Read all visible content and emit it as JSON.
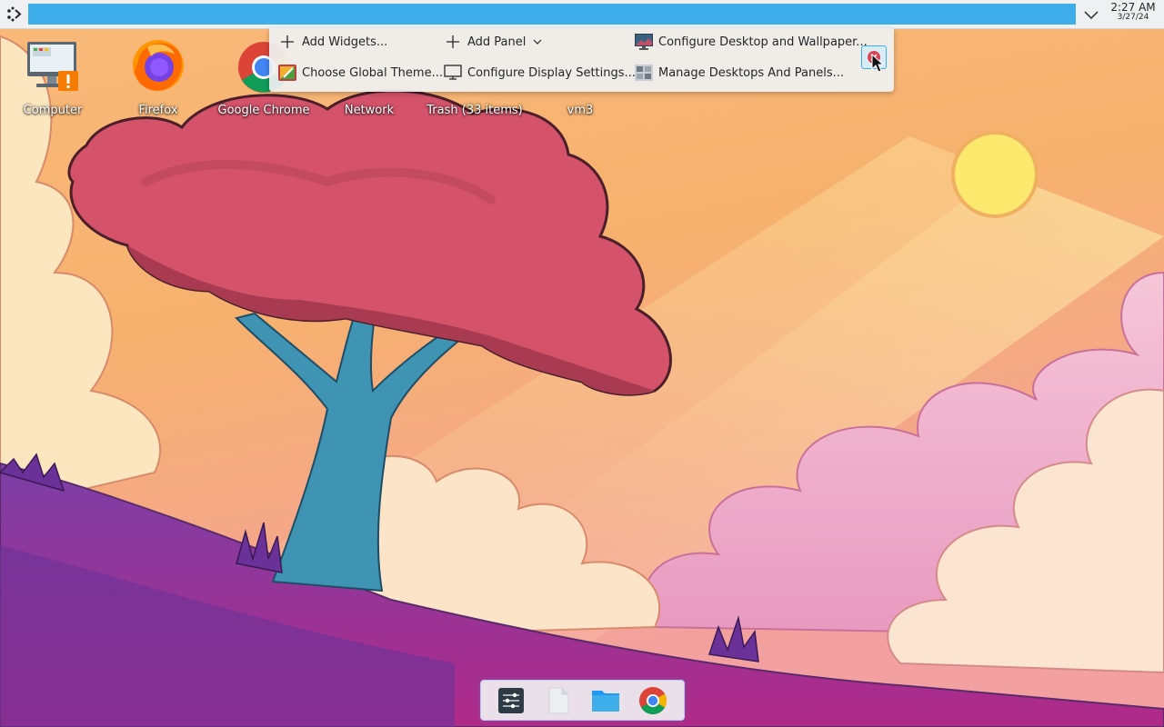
{
  "top_panel": {
    "clock": {
      "time": "2:27 AM",
      "date": "3/27/24"
    }
  },
  "desktop_icons": [
    {
      "label": "Computer",
      "icon": "computer-warning-icon"
    },
    {
      "label": "Firefox",
      "icon": "firefox-icon"
    },
    {
      "label": "Google Chrome",
      "icon": "chrome-icon"
    },
    {
      "label": "Network",
      "icon": "network-icon"
    },
    {
      "label": "Trash (33 items)",
      "icon": "trash-icon"
    },
    {
      "label": "vm3",
      "icon": "folder-icon"
    }
  ],
  "toolbox": {
    "add_widgets": "Add Widgets...",
    "add_panel": "Add Panel",
    "configure_desktop": "Configure Desktop and Wallpaper...",
    "global_theme": "Choose Global Theme...",
    "display_settings": "Configure Display Settings...",
    "manage_desktops": "Manage Desktops And Panels..."
  },
  "dock": {
    "apps": [
      "settings-icon",
      "text-file-icon",
      "folder-icon",
      "chrome-icon"
    ]
  },
  "colors": {
    "accent": "#3daee9",
    "panel": "#eff0f1"
  }
}
